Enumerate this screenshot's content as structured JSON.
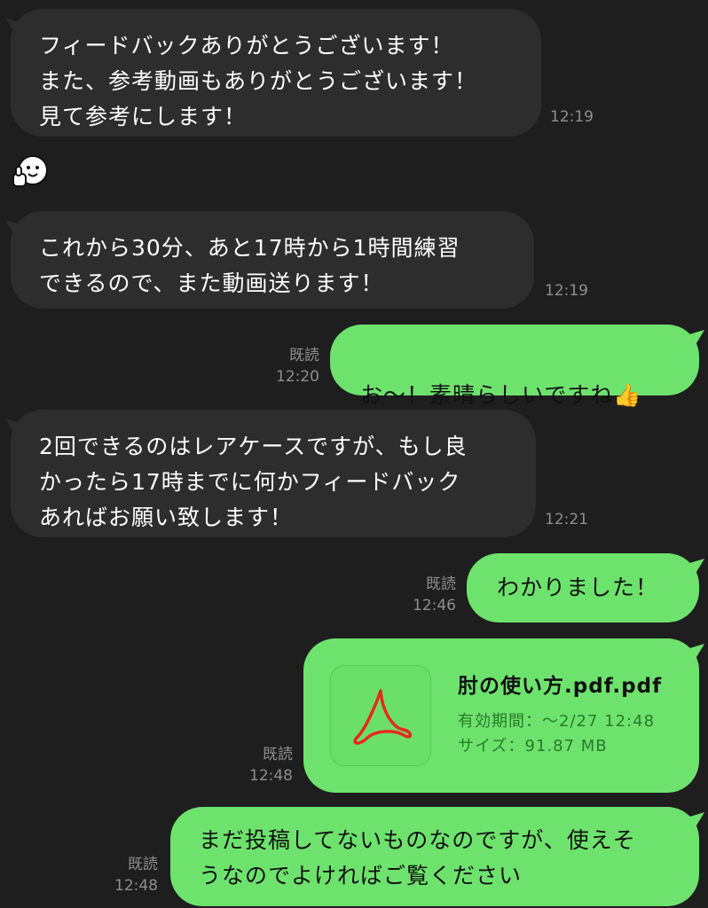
{
  "messages": [
    {
      "side": "in",
      "text": "フィードバックありがとうございます！\nまた、参考動画もありがとうございます！\n見て参考にします！",
      "time": "12:19"
    },
    {
      "side": "in",
      "type": "sticker",
      "icon": "thumbs-up-face-sticker"
    },
    {
      "side": "in",
      "text": "これから30分、あと17時から1時間練習\nできるので、また動画送ります！",
      "time": "12:19"
    },
    {
      "side": "out",
      "text": "お〜！素晴らしいですね",
      "emoji": "👍",
      "read": "既読",
      "time": "12:20"
    },
    {
      "side": "in",
      "text": "2回できるのはレアケースですが、もし良\nかったら17時までに何かフィードバック\nあればお願い致します！",
      "time": "12:21"
    },
    {
      "side": "out",
      "text": "わかりました！",
      "read": "既読",
      "time": "12:46"
    },
    {
      "side": "out",
      "type": "file",
      "file_name": "肘の使い方.pdf.pdf",
      "expiry": "有効期間：〜2/27 12:48",
      "size": "サイズ：91.87 MB",
      "icon": "pdf-icon",
      "read": "既読",
      "time": "12:48"
    },
    {
      "side": "out",
      "text": "まだ投稿してないものなのですが、使えそ\nうなのでよければご覧ください",
      "read": "既読",
      "time": "12:48"
    }
  ],
  "colors": {
    "background": "#1e1e1e",
    "incoming_bubble": "#2d2d2d",
    "outgoing_bubble": "#6de36d",
    "timestamp": "#8e8e8e",
    "pdf_red": "#e8281e"
  }
}
